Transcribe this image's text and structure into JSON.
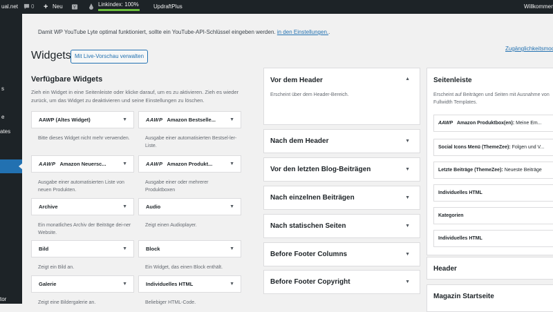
{
  "adminbar": {
    "site": "ual.net",
    "comments_count": "0",
    "new_label": "Neu",
    "linkindex": "Linkindex: 100%",
    "updraft": "UpdraftPlus",
    "welcome": "Willkommen"
  },
  "sidebar": {
    "items": [
      "s",
      "e",
      "ates",
      "tor"
    ]
  },
  "notice": {
    "text": "Damit WP YouTube Lyte optimal funktioniert, sollte ein YouTube-API-Schlüssel eingeben werden.",
    "link": "in den Einstellungen.",
    "dot": "."
  },
  "page": {
    "title": "Widgets",
    "live_button": "Mit Live-Vorschau verwalten",
    "a11y_link": "Zugänglichkeitsmodus"
  },
  "available": {
    "title": "Verfügbare Widgets",
    "desc": "Zieh ein Widget in eine Seitenleiste oder klicke darauf, um es zu aktivieren. Zieh es wieder zurück, um das Widget zu deaktivieren und seine Einstellungen zu löschen.",
    "widgets": [
      {
        "name": "AAWP (Altes Widget)",
        "desc": "Bitte dieses Widget nicht mehr verwenden.",
        "aawp": false
      },
      {
        "name": "Amazon Bestselle...",
        "desc": "Ausgabe einer automatisierten Bestsel-ler-Liste.",
        "aawp": true
      },
      {
        "name": "Amazon Neuersc...",
        "desc": "Ausgabe einer automatisierten Liste von neuen Produkten.",
        "aawp": true
      },
      {
        "name": "Amazon Produkt...",
        "desc": "Ausgabe einer oder mehrerer Produktboxen",
        "aawp": true
      },
      {
        "name": "Archive",
        "desc": "Ein monatliches Archiv der Beiträge dei-ner Website.",
        "aawp": false
      },
      {
        "name": "Audio",
        "desc": "Zeigt einen Audioplayer.",
        "aawp": false
      },
      {
        "name": "Bild",
        "desc": "Zeigt ein Bild an.",
        "aawp": false
      },
      {
        "name": "Block",
        "desc": "Ein Widget, das einen Block enthält.",
        "aawp": false
      },
      {
        "name": "Galerie",
        "desc": "Zeigt eine Bildergalerie an.",
        "aawp": false
      },
      {
        "name": "Individuelles HTML",
        "desc": "Beliebiger HTML-Code.",
        "aawp": false
      }
    ],
    "aawp_logo": "AAWP"
  },
  "areas_mid": [
    {
      "title": "Vor dem Header",
      "desc": "Erscheint über dem Header-Bereich.",
      "open": true
    },
    {
      "title": "Nach dem Header"
    },
    {
      "title": "Vor den letzten Blog-Beiträgen"
    },
    {
      "title": "Nach einzelnen Beiträgen"
    },
    {
      "title": "Nach statischen Seiten"
    },
    {
      "title": "Before Footer Columns"
    },
    {
      "title": "Before Footer Copyright"
    }
  ],
  "right": {
    "title": "Seitenleiste",
    "desc": "Erscheint auf Beiträgen und Seiten mit Ausnahme von Fullwidth Templates.",
    "widgets": [
      {
        "prefix": "AAWP",
        "name": "Amazon Produktbox(en):",
        "tail": " Meine Em..."
      },
      {
        "prefix": "",
        "name": "Social Icons Menü (ThemeZee):",
        "tail": " Folgen und V..."
      },
      {
        "prefix": "",
        "name": "Letzte Beiträge (ThemeZee):",
        "tail": " Neueste Beiträge"
      },
      {
        "prefix": "",
        "name": "Individuelles HTML",
        "tail": ""
      },
      {
        "prefix": "",
        "name": "Kategorien",
        "tail": ""
      },
      {
        "prefix": "",
        "name": "Individuelles HTML",
        "tail": ""
      }
    ],
    "header_title": "Header",
    "magazin_title": "Magazin Startseite"
  },
  "icons": {
    "arrow_down": "▼",
    "arrow_up": "▲"
  }
}
